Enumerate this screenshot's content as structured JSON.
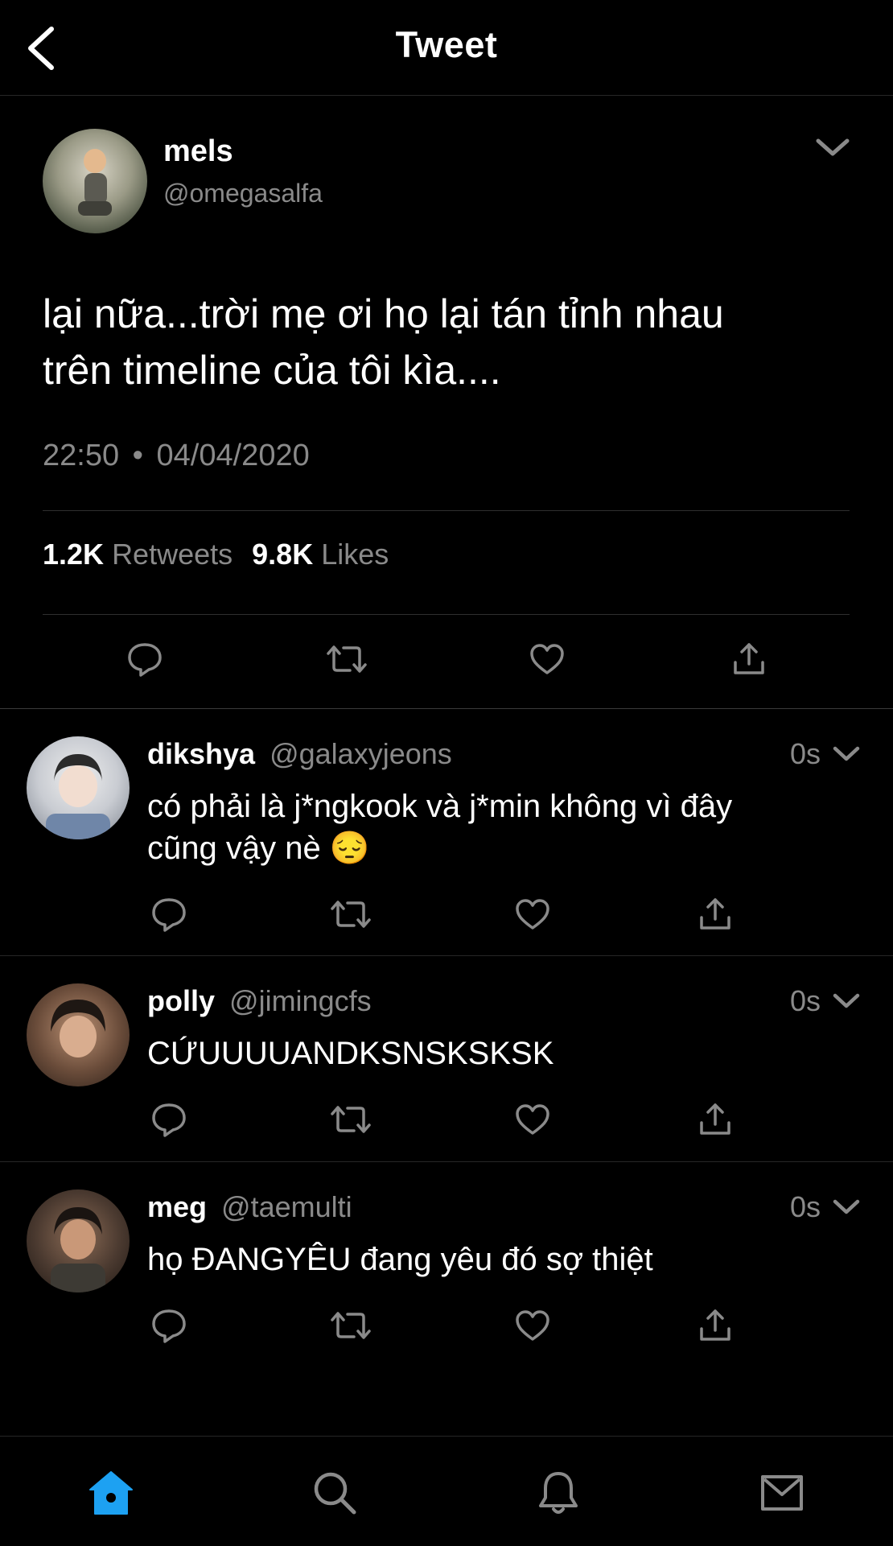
{
  "header": {
    "title": "Tweet",
    "back_icon": "chevron-left-icon"
  },
  "tweet": {
    "name": "mels",
    "handle": "@omegasalfa",
    "text_line1": "lại nữa...trời mẹ ơi họ lại tán tỉnh nhau",
    "text_line2": "trên timeline của tôi kìa....",
    "time": "22:50",
    "separator": "•",
    "date": "04/04/2020",
    "retweets_count": "1.2K",
    "retweets_label": "Retweets",
    "likes_count": "9.8K",
    "likes_label": "Likes"
  },
  "replies": [
    {
      "name": "dikshya",
      "handle": "@galaxyjeons",
      "time": "0s",
      "line1": "có phải là j*ngkook và j*min không vì đây",
      "line2": "cũng vậy nè 😔"
    },
    {
      "name": "polly",
      "handle": "@jimingcfs",
      "time": "0s",
      "line1": "CỨUUUUANDKSNSKSKSK"
    },
    {
      "name": "meg",
      "handle": "@taemulti",
      "time": "0s",
      "line1": "họ ĐANGYÊU đang yêu đó sợ thiệt"
    }
  ],
  "colors": {
    "background": "#000000",
    "text": "#ffffff",
    "muted": "#8a8a8a",
    "accent": "#1da1f2",
    "divider": "#2f2f2f"
  },
  "bottom_nav": [
    "home-icon",
    "search-icon",
    "notifications-icon",
    "messages-icon"
  ]
}
